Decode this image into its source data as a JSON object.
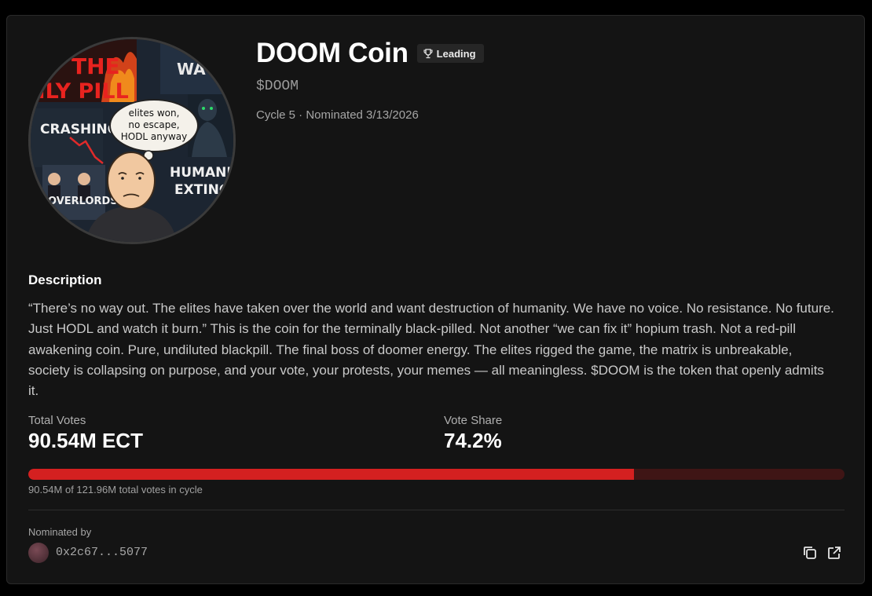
{
  "coin": {
    "name": "DOOM Coin",
    "badge": "Leading",
    "ticker": "$DOOM",
    "meta": "Cycle 5 · Nominated 3/13/2026"
  },
  "image_text": {
    "only_pill": "NLY PILL",
    "the": "THE",
    "crashing": "CRASHING",
    "overlords": "OVERLORDS",
    "humanity": "HUMANITY",
    "extinct": "EXTINCT",
    "thought_1": "elites won,",
    "thought_2": "no escape,",
    "thought_3": "HODL anyway"
  },
  "description": {
    "heading": "Description",
    "text": "“There’s no way out. The elites have taken over the world and want destruction of humanity. We have no voice. No resistance. No future. Just HODL and watch it burn.” This is the coin for the terminally black-pilled. Not another “we can fix it” hopium trash. Not a red-pill awakening coin. Pure, undiluted blackpill. The final boss of doomer energy. The elites rigged the game, the matrix is unbreakable, society is collapsing on purpose, and your vote, your protests, your memes — all meaningless. $DOOM is the token that openly admits it."
  },
  "stats": {
    "total_votes_label": "Total Votes",
    "total_votes_value": "90.54M ECT",
    "vote_share_label": "Vote Share",
    "vote_share_value": "74.2%",
    "progress_fraction": 0.742,
    "progress_caption": "90.54M of 121.96M total votes in cycle"
  },
  "nominator": {
    "label": "Nominated by",
    "address": "0x2c67...5077"
  },
  "icons": {
    "badge": "trophy-icon",
    "copy": "copy-icon",
    "external": "external-link-icon"
  },
  "colors": {
    "accent": "#d42020",
    "track": "#3f1515"
  }
}
